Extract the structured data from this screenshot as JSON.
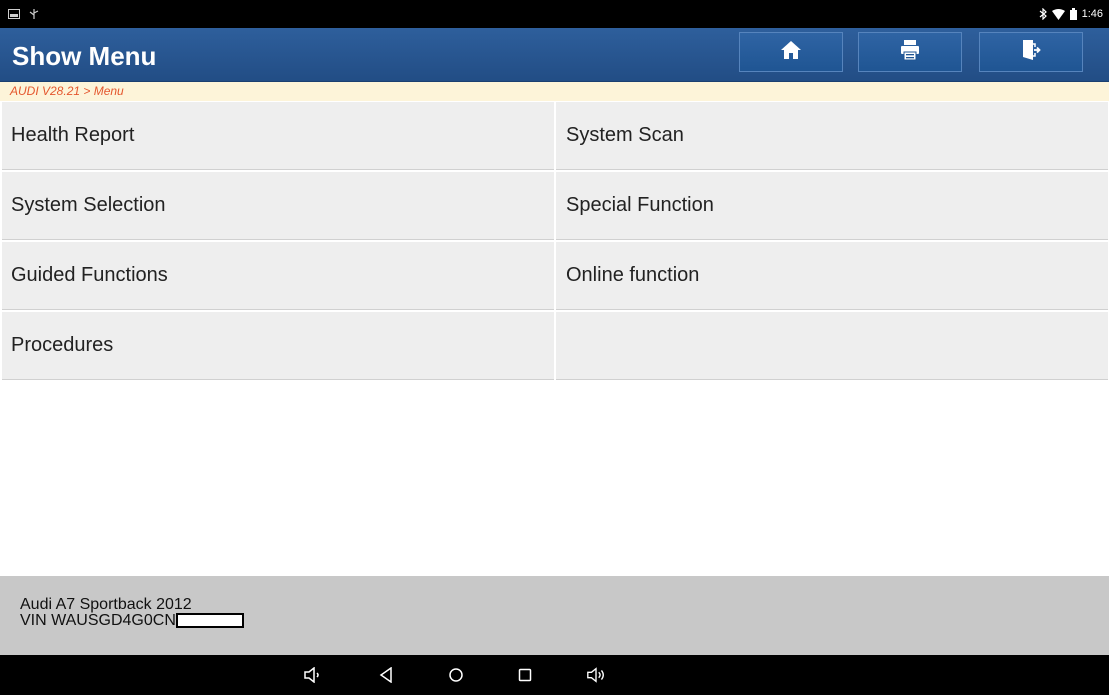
{
  "status_bar": {
    "time": "1:46",
    "icons": [
      "screenshot-icon",
      "usb-icon",
      "bluetooth-icon",
      "wifi-icon",
      "battery-icon"
    ]
  },
  "header": {
    "title": "Show Menu",
    "buttons": [
      {
        "name": "home",
        "icon": "home-icon"
      },
      {
        "name": "print",
        "icon": "printer-icon"
      },
      {
        "name": "exit",
        "icon": "exit-icon"
      }
    ]
  },
  "breadcrumb": "AUDI V28.21 > Menu",
  "menu": {
    "items": [
      "Health Report",
      "System Scan",
      "System Selection",
      "Special Function",
      "Guided Functions",
      "Online function",
      "Procedures",
      ""
    ]
  },
  "vehicle": {
    "model": "Audi A7 Sportback 2012",
    "vin_prefix": "VIN WAUSGD4G0CN"
  },
  "nav_bar": {
    "icons": [
      "volume-down-icon",
      "back-icon",
      "home-circle-icon",
      "recents-icon",
      "volume-up-icon"
    ]
  },
  "colors": {
    "header_blue": "#2a5a96",
    "breadcrumb_text": "#e4572e",
    "breadcrumb_bg": "#fdf4d9",
    "menu_bg": "#eeeeee",
    "footer_bg": "#c8c8c8"
  }
}
